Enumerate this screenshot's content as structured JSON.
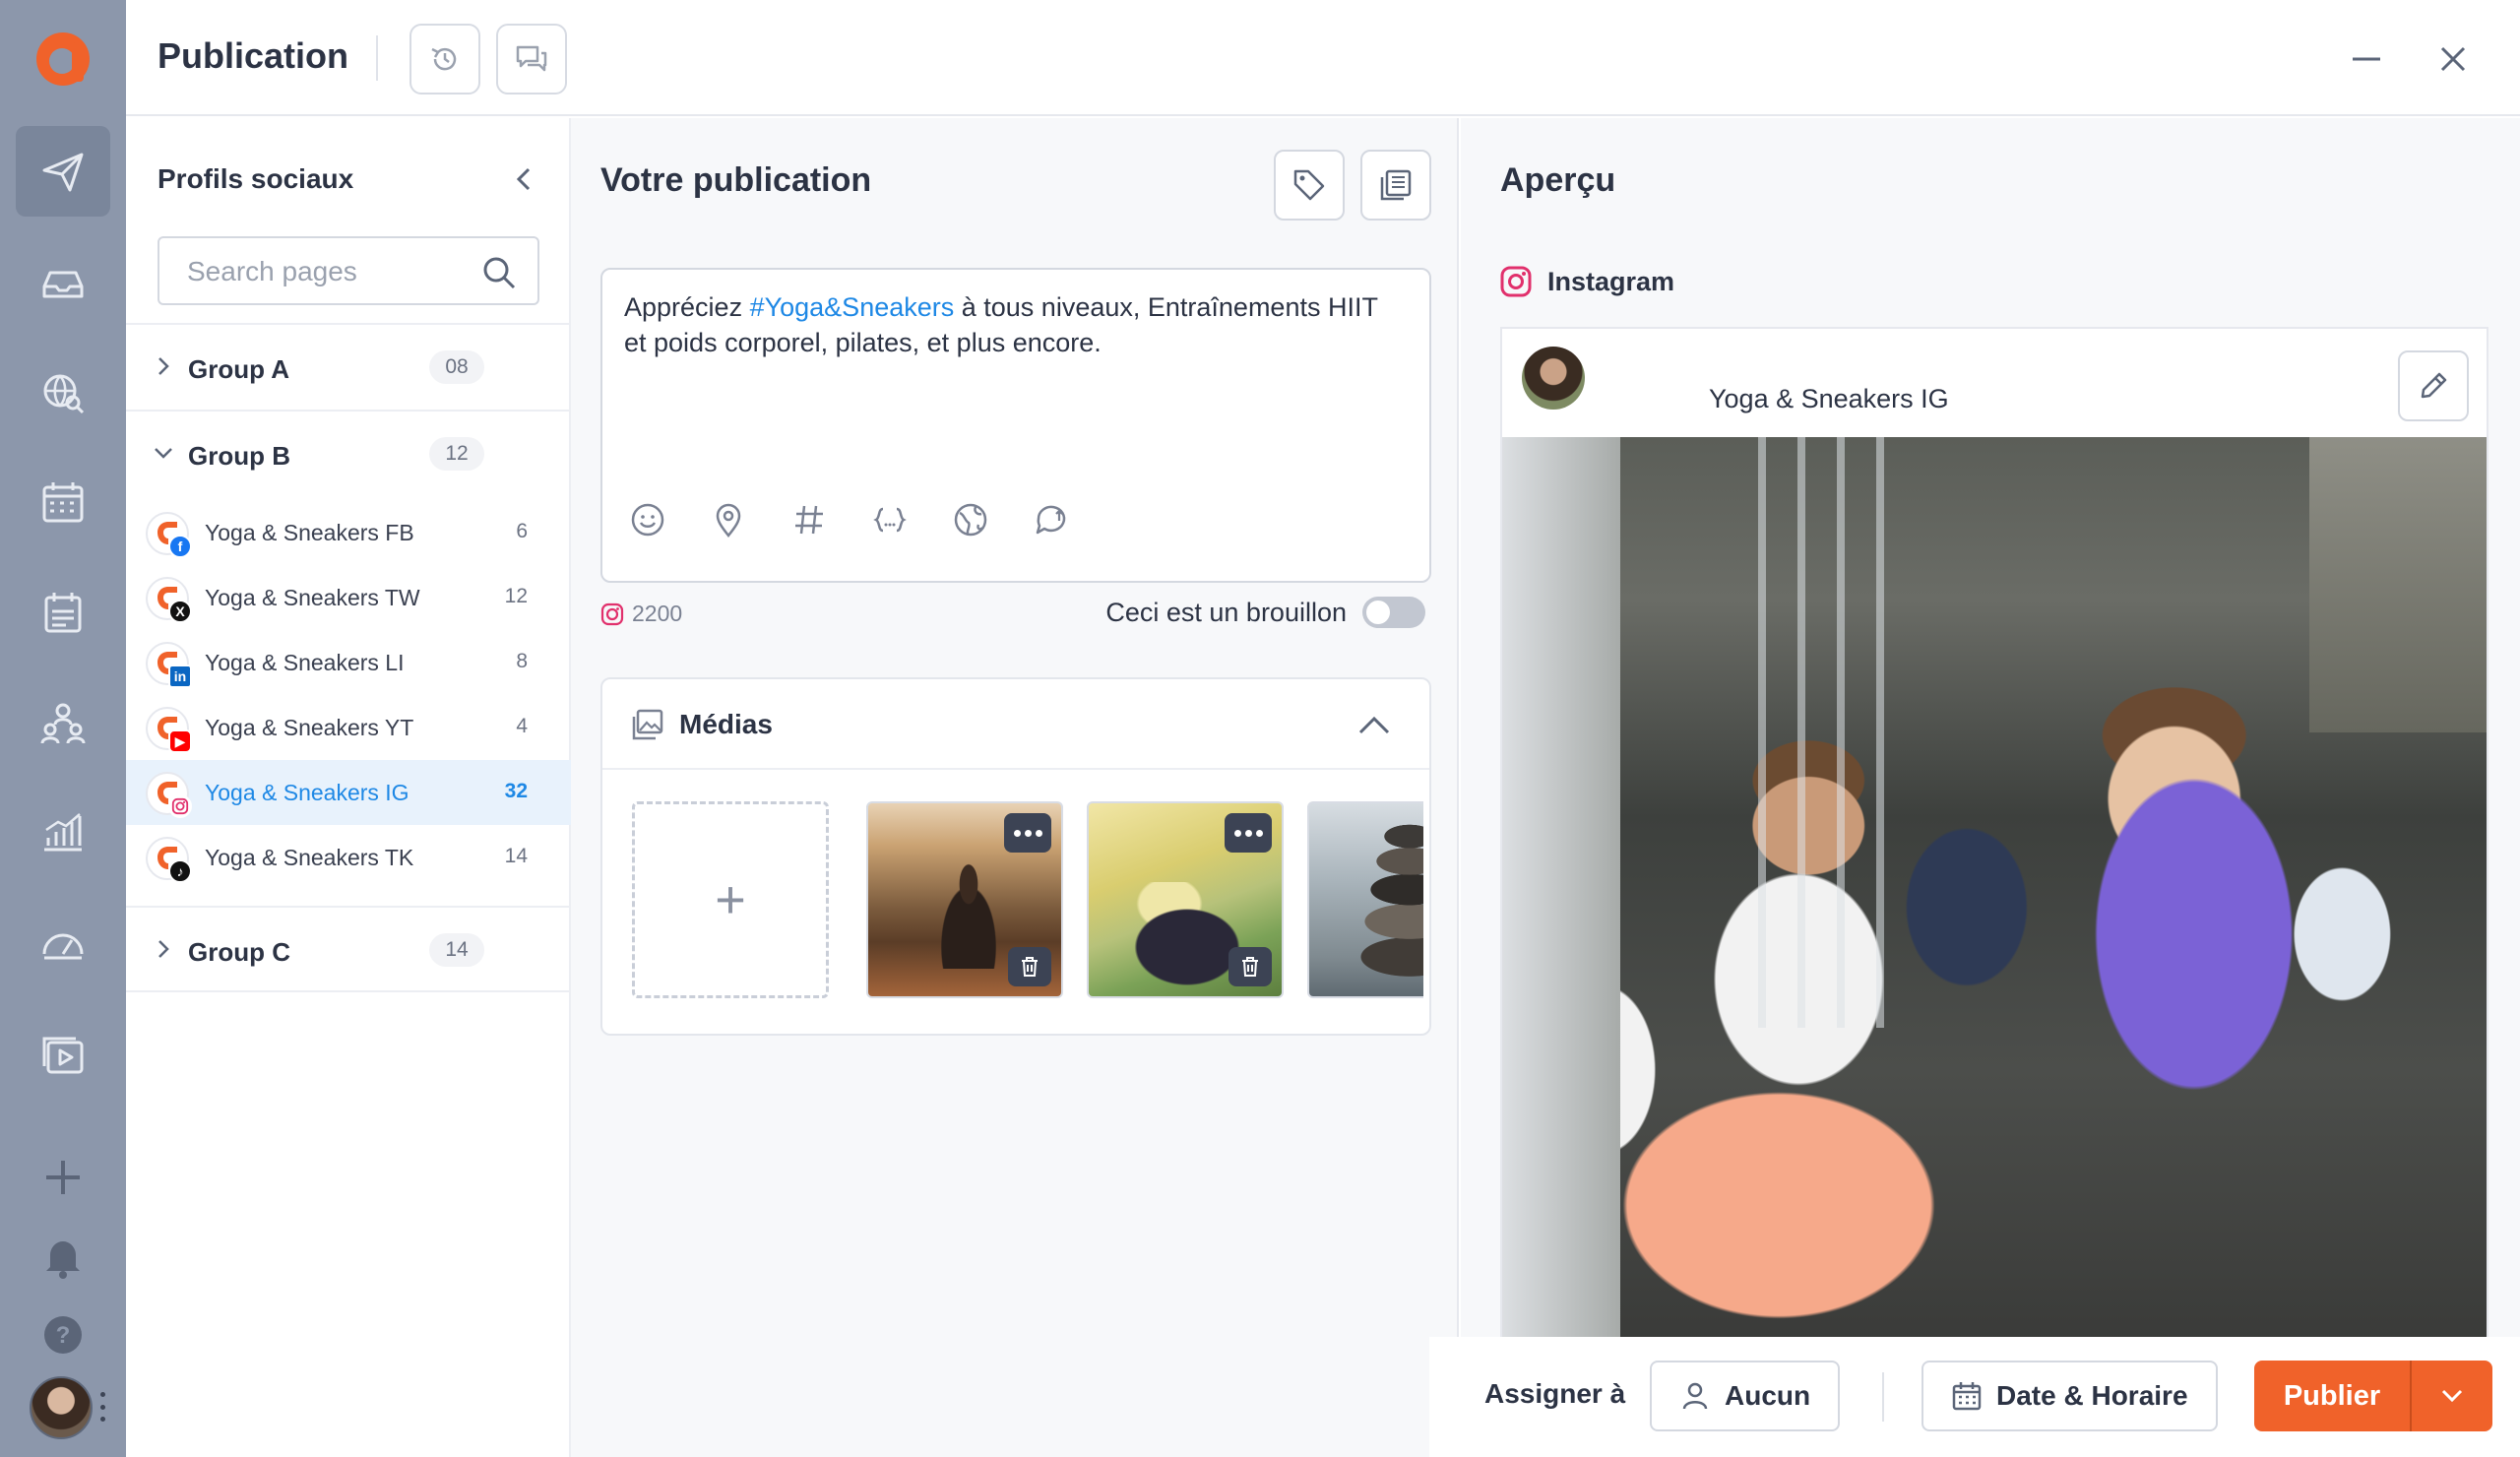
{
  "colors": {
    "brand": "#f0622a",
    "link": "#1e88e5",
    "rail": "#8c97ab",
    "text": "#2c3344"
  },
  "rail": {
    "items": [
      {
        "name": "publish-icon",
        "active": true
      },
      {
        "name": "inbox-icon"
      },
      {
        "name": "listening-icon"
      },
      {
        "name": "calendar-icon"
      },
      {
        "name": "planner-icon"
      },
      {
        "name": "team-icon"
      },
      {
        "name": "analytics-icon"
      },
      {
        "name": "dashboard-icon"
      },
      {
        "name": "media-library-icon"
      },
      {
        "name": "add-icon"
      },
      {
        "name": "bell-icon"
      },
      {
        "name": "help-icon"
      }
    ]
  },
  "header": {
    "title": "Publication"
  },
  "profiles": {
    "title": "Profils sociaux",
    "search_placeholder": "Search pages",
    "groups": [
      {
        "label": "Group A",
        "count": "08",
        "expanded": false
      },
      {
        "label": "Group B",
        "count": "12",
        "expanded": true
      },
      {
        "label": "Group C",
        "count": "14",
        "expanded": false
      }
    ],
    "items": [
      {
        "label": "Yoga & Sneakers FB",
        "count": "6",
        "network": "facebook"
      },
      {
        "label": "Yoga & Sneakers TW",
        "count": "12",
        "network": "x"
      },
      {
        "label": "Yoga & Sneakers LI",
        "count": "8",
        "network": "linkedin"
      },
      {
        "label": "Yoga & Sneakers YT",
        "count": "4",
        "network": "youtube"
      },
      {
        "label": "Yoga & Sneakers IG",
        "count": "32",
        "network": "instagram",
        "selected": true
      },
      {
        "label": "Yoga & Sneakers TK",
        "count": "14",
        "network": "tiktok"
      }
    ]
  },
  "composer": {
    "title": "Votre publication",
    "text_before": "Appréciez ",
    "hashtag": "#Yoga&Sneakers",
    "text_after": " à tous niveaux, Entraînements HIIT et poids corporel, pilates, et plus encore.",
    "char_count": "2200",
    "draft_label": "Ceci est un brouillon",
    "draft_on": false,
    "tools": [
      "emoji-icon",
      "location-icon",
      "hashtag-icon",
      "variables-icon",
      "language-icon",
      "comment-icon"
    ]
  },
  "media": {
    "title": "Médias",
    "add_label": "+"
  },
  "preview": {
    "title": "Aperçu",
    "network": "Instagram",
    "account_name": "Yoga & Sneakers IG"
  },
  "actions": {
    "assign_label": "Assigner à",
    "assignee": "Aucun",
    "date_label": "Date & Horaire",
    "publish_label": "Publier"
  }
}
